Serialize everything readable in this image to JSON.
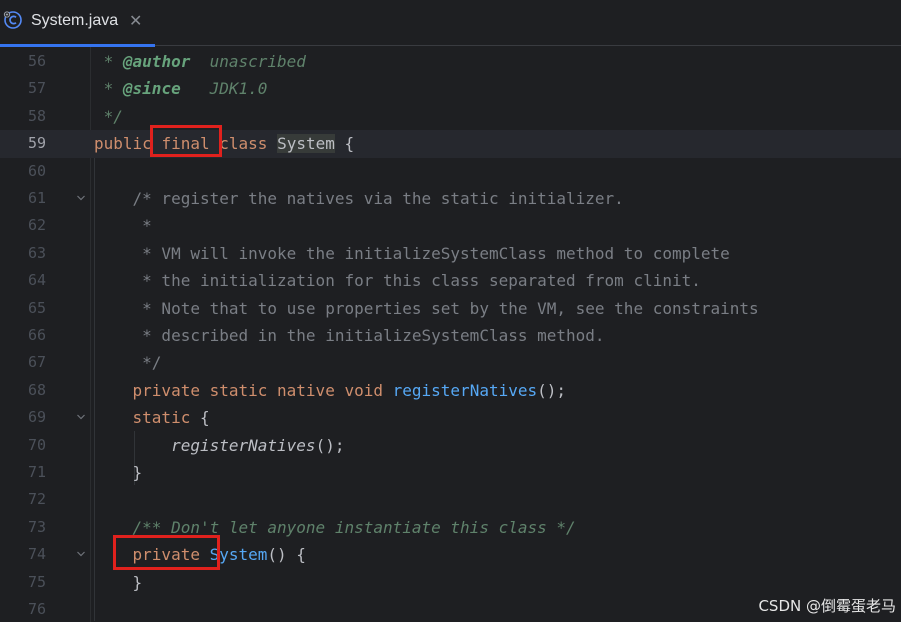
{
  "tab": {
    "label": "System.java",
    "close": "✕",
    "icon": "java-class-icon"
  },
  "lines": [
    {
      "num": "56"
    },
    {
      "num": "57"
    },
    {
      "num": "58"
    },
    {
      "num": "59"
    },
    {
      "num": "60"
    },
    {
      "num": "61"
    },
    {
      "num": "62"
    },
    {
      "num": "63"
    },
    {
      "num": "64"
    },
    {
      "num": "65"
    },
    {
      "num": "66"
    },
    {
      "num": "67"
    },
    {
      "num": "68"
    },
    {
      "num": "69"
    },
    {
      "num": "70"
    },
    {
      "num": "71"
    },
    {
      "num": "72"
    },
    {
      "num": "73"
    },
    {
      "num": "74"
    },
    {
      "num": "75"
    },
    {
      "num": "76"
    }
  ],
  "code": {
    "l56_star": " * ",
    "l56_tag": "@author",
    "l56_text": "  unascribed",
    "l57_star": " * ",
    "l57_tag": "@since",
    "l57_text": "   JDK1.0",
    "l58": " */",
    "l59_public": "public",
    "l59_final": "final",
    "l59_class": "class",
    "l59_name": "System",
    "l59_brace": " {",
    "l61": "    /* register the natives via the static initializer.",
    "l62": "     *",
    "l63": "     * VM will invoke the initializeSystemClass method to complete",
    "l64": "     * the initialization for this class separated from clinit.",
    "l65": "     * Note that to use properties set by the VM, see the constraints",
    "l66": "     * described in the initializeSystemClass method.",
    "l67": "     */",
    "l68_mods": "private static native void",
    "l68_fn": "registerNatives",
    "l68_end": "();",
    "l69_kw": "static",
    "l69_end": " {",
    "l70_fn": "registerNatives",
    "l70_end": "();",
    "l71": "}",
    "l73": "/** Don't let anyone instantiate this class */",
    "l74_kw": "private",
    "l74_fn": "System",
    "l74_end": "() {",
    "l75": "}"
  },
  "watermark": "CSDN @倒霉蛋老马",
  "colors": {
    "background": "#1e1f22",
    "keyword": "#cf8e6d",
    "method": "#56a8f5",
    "comment": "#7a7e85",
    "doc": "#5f826b",
    "annotation_box": "#e0211d",
    "tab_accent": "#3574f0"
  }
}
